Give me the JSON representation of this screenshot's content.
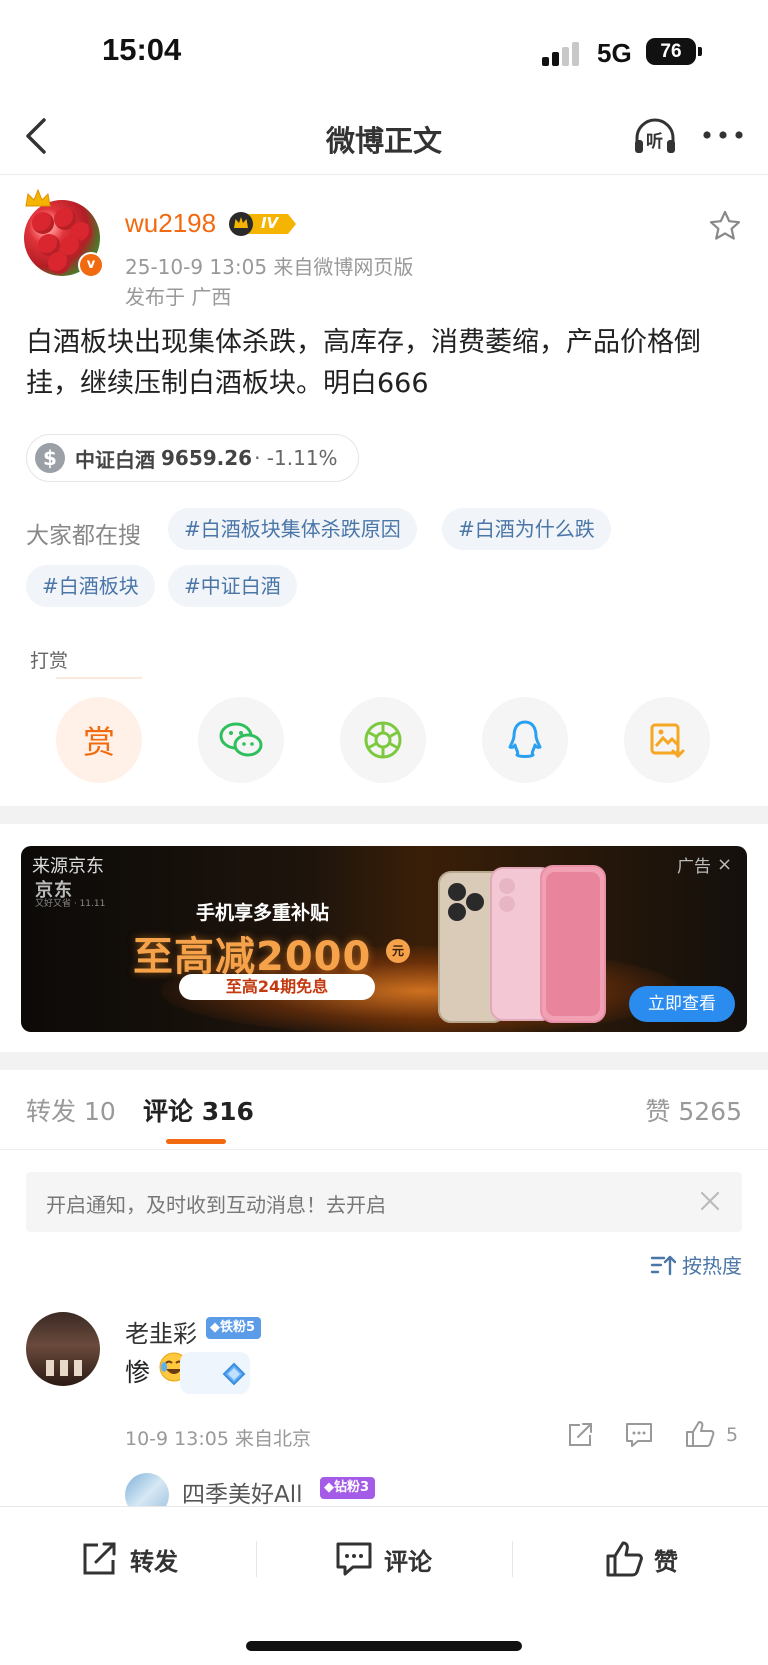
{
  "status_bar": {
    "time": "15:04",
    "network": "5G",
    "battery": "76"
  },
  "nav": {
    "title": "微博正文",
    "back_icon": "chevron-left-icon",
    "listen_icon": "headphones-listen-icon",
    "listen_label": "听",
    "more_icon": "more-dots-icon"
  },
  "post": {
    "username": "wu2198",
    "level_badge": "IV",
    "verified_badge": "v",
    "meta": "25-10-9 13:05  来自微博网页版",
    "location": "发布于 广西",
    "text": "白酒板块出现集体杀跌，高库存，消费萎缩，产品价格倒挂，继续压制白酒板块。明白666",
    "stock": {
      "icon": "$",
      "name": "中证白酒",
      "value": "9659.26",
      "change": "· -1.11%"
    },
    "search_label": "大家都在搜",
    "tags": [
      "#白酒板块集体杀跌原因",
      "#白酒为什么跌",
      "#白酒板块",
      "#中证白酒"
    ],
    "reward_label": "打赏",
    "reward_button": "赏",
    "share_icons": [
      "wechat-icon",
      "moments-icon",
      "qq-icon",
      "save-image-icon"
    ]
  },
  "ad": {
    "source": "来源京东",
    "brand": "京东",
    "brand_sub": "又好又省 · 11.11",
    "label": "广告",
    "close": "×",
    "headline": "手机享多重补贴",
    "big_text": "至高减2000",
    "unit": "元",
    "pill": "至高24期免息",
    "cta": "立即查看"
  },
  "tabs": {
    "repost": "转发 10",
    "comment": "评论 316",
    "like": "赞 5265"
  },
  "notice": {
    "text": "开启通知，及时收到互动消息！去开启"
  },
  "sort": {
    "label": "按热度"
  },
  "comment": {
    "name": "老韭彩",
    "badge": "铁粉5",
    "text": "惨",
    "meta": "10-9 13:05  来自北京",
    "like_count": "5"
  },
  "reply": {
    "name": "四季美好All",
    "badge": "钻粉3"
  },
  "bottom_bar": {
    "repost": "转发",
    "comment": "评论",
    "like": "赞"
  },
  "colors": {
    "accent": "#f26a0f",
    "link": "#4a76a8",
    "cta": "#2b8cf0"
  }
}
